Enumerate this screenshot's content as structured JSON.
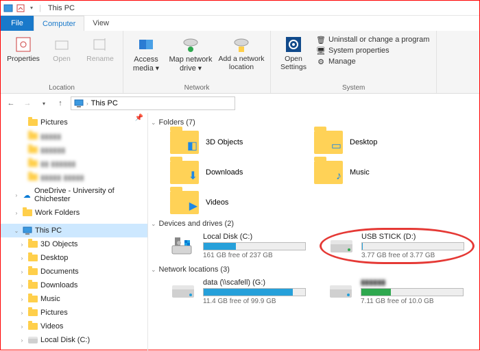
{
  "window": {
    "title": "This PC"
  },
  "tabs": {
    "file": "File",
    "computer": "Computer",
    "view": "View"
  },
  "ribbon": {
    "location": {
      "name": "Location",
      "properties": "Properties",
      "open": "Open",
      "rename": "Rename"
    },
    "network": {
      "name": "Network",
      "access": "Access media",
      "map": "Map network drive",
      "add": "Add a network location"
    },
    "system": {
      "name": "System",
      "open_settings": "Open Settings",
      "uninstall": "Uninstall or change a program",
      "sysprops": "System properties",
      "manage": "Manage"
    }
  },
  "address": {
    "current": "This PC"
  },
  "sidebar": {
    "pictures": "Pictures",
    "redact": [
      "▮▮▮▮▮",
      "▮▮▮▮▮▮",
      "▮▮ ▮▮▮▮▮▮",
      "▮▮▮▮▮ ▮▮▮▮▮"
    ],
    "onedrive": "OneDrive - University of Chichester",
    "workfolders": "Work Folders",
    "thispc": "This PC",
    "children": [
      "3D Objects",
      "Desktop",
      "Documents",
      "Downloads",
      "Music",
      "Pictures",
      "Videos",
      "Local Disk (C:)"
    ]
  },
  "sections": {
    "folders": {
      "header": "Folders (7)",
      "items": [
        "3D Objects",
        "Desktop",
        "Downloads",
        "Music",
        "Videos"
      ]
    },
    "drives": {
      "header": "Devices and drives (2)",
      "items": [
        {
          "name": "Local Disk (C:)",
          "free": "161 GB free of 237 GB",
          "pct": 32,
          "kind": "local"
        },
        {
          "name": "USB STICK (D:)",
          "free": "3.77 GB free of 3.77 GB",
          "pct": 1,
          "kind": "usb",
          "highlight": true
        }
      ]
    },
    "netloc": {
      "header": "Network locations (3)",
      "items": [
        {
          "name": "data (\\\\scafell) (G:)",
          "free": "11.4 GB free of 99.9 GB",
          "pct": 88
        },
        {
          "name": "▮▮▮▮▮▮",
          "free": "7.11 GB free of 10.0 GB",
          "pct": 29,
          "blurName": true
        }
      ]
    }
  }
}
